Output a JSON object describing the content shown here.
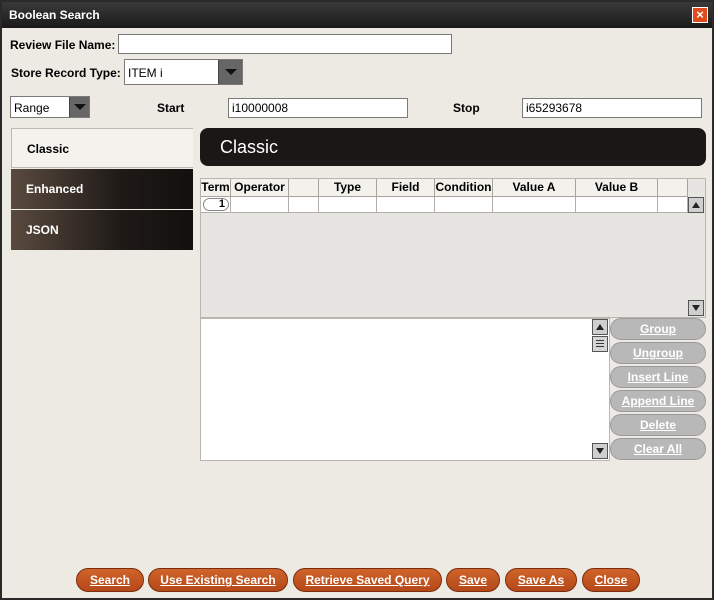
{
  "window": {
    "title": "Boolean Search"
  },
  "review_file": {
    "label": "Review File Name:",
    "value": ""
  },
  "store_record": {
    "label": "Store Record Type:",
    "value": "ITEM  i"
  },
  "range": {
    "mode": "Range",
    "start_label": "Start",
    "start_value": "i10000008",
    "stop_label": "Stop",
    "stop_value": "i65293678"
  },
  "tabs": [
    {
      "label": "Classic",
      "active": true
    },
    {
      "label": "Enhanced",
      "active": false
    },
    {
      "label": "JSON",
      "active": false
    }
  ],
  "panel": {
    "title": "Classic"
  },
  "grid": {
    "columns": [
      "Term",
      "Operator",
      "",
      "Type",
      "Field",
      "Condition",
      "Value A",
      "Value B",
      ""
    ],
    "rows": [
      {
        "term": "1"
      }
    ]
  },
  "side_buttons": [
    "Group",
    "Ungroup",
    "Insert Line",
    "Append Line",
    "Delete",
    "Clear All"
  ],
  "bottom_buttons": [
    "Search",
    "Use Existing Search",
    "Retrieve Saved Query",
    "Save",
    "Save As",
    "Close"
  ],
  "colors": {
    "accent": "#c0561f",
    "dark_tab": "#1a1716",
    "disabled_button": "#b8b8b8"
  }
}
